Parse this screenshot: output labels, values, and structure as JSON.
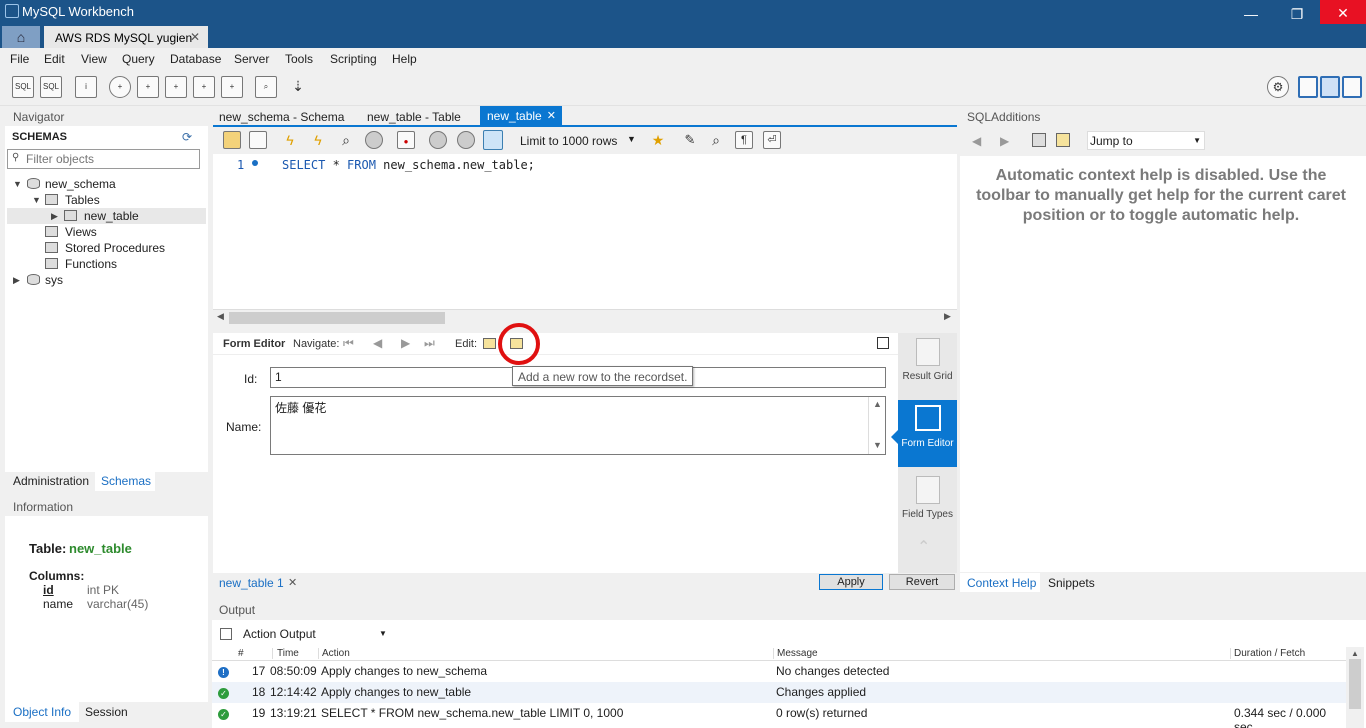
{
  "window": {
    "title": "MySQL Workbench",
    "connection_tab": "AWS RDS MySQL yugien",
    "close_symbol": "✕",
    "minimize_symbol": "—",
    "restore_symbol": "❐"
  },
  "menu": [
    "File",
    "Edit",
    "View",
    "Query",
    "Database",
    "Server",
    "Tools",
    "Scripting",
    "Help"
  ],
  "navigator": {
    "header": "Navigator",
    "schemas_label": "SCHEMAS",
    "filter_placeholder": "Filter objects",
    "tree": {
      "schema": "new_schema",
      "tables": "Tables",
      "table": "new_table",
      "views": "Views",
      "procedures": "Stored Procedures",
      "functions": "Functions",
      "sys": "sys"
    },
    "tabs": [
      "Administration",
      "Schemas"
    ]
  },
  "information": {
    "header": "Information",
    "table_label": "Table:",
    "table_name": "new_table",
    "columns_label": "Columns:",
    "columns": [
      {
        "name": "id",
        "type": "int PK"
      },
      {
        "name": "name",
        "type": "varchar(45)"
      }
    ],
    "tabs": [
      "Object Info",
      "Session"
    ]
  },
  "editor": {
    "tabs": [
      "new_schema - Schema",
      "new_table - Table",
      "new_table"
    ],
    "limit": "Limit to 1000 rows",
    "line_number": "1",
    "sql": {
      "kw1": "SELECT",
      "star": " * ",
      "kw2": "FROM",
      "rest": " new_schema.new_table;"
    }
  },
  "form_editor": {
    "title": "Form Editor",
    "navigate": "Navigate:",
    "edit": "Edit:",
    "tooltip": "Add a new row to the recordset.",
    "fields": {
      "id_label": "Id:",
      "id_value": "1",
      "name_label": "Name:",
      "name_value": "佐藤 優花"
    },
    "result_tab": "new_table 1",
    "apply": "Apply",
    "revert": "Revert"
  },
  "side_buttons": {
    "result_grid": "Result Grid",
    "form_editor": "Form Editor",
    "field_types": "Field Types"
  },
  "sql_additions": {
    "header": "SQLAdditions",
    "jump_to": "Jump to",
    "help_text": "Automatic context help is disabled. Use the toolbar to manually get help for the current caret position or to toggle automatic help.",
    "tabs": [
      "Context Help",
      "Snippets"
    ]
  },
  "output": {
    "header": "Output",
    "selector": "Action Output",
    "columns": [
      "#",
      "Time",
      "Action",
      "Message",
      "Duration / Fetch"
    ],
    "rows": [
      {
        "num": "17",
        "time": "08:50:09",
        "action": "Apply changes to new_schema",
        "message": "No changes detected",
        "duration": "",
        "status": "info"
      },
      {
        "num": "18",
        "time": "12:14:42",
        "action": "Apply changes to new_table",
        "message": "Changes applied",
        "duration": "",
        "status": "ok"
      },
      {
        "num": "19",
        "time": "13:19:21",
        "action": "SELECT * FROM new_schema.new_table LIMIT 0, 1000",
        "message": "0 row(s) returned",
        "duration": "0.344 sec / 0.000 sec",
        "status": "ok"
      }
    ]
  },
  "colors": {
    "titlebar": "#1c5489",
    "accent": "#0a77d1",
    "highlight_circle": "#e01010",
    "ok": "#2e9c3d",
    "info": "#1f6fc5"
  }
}
